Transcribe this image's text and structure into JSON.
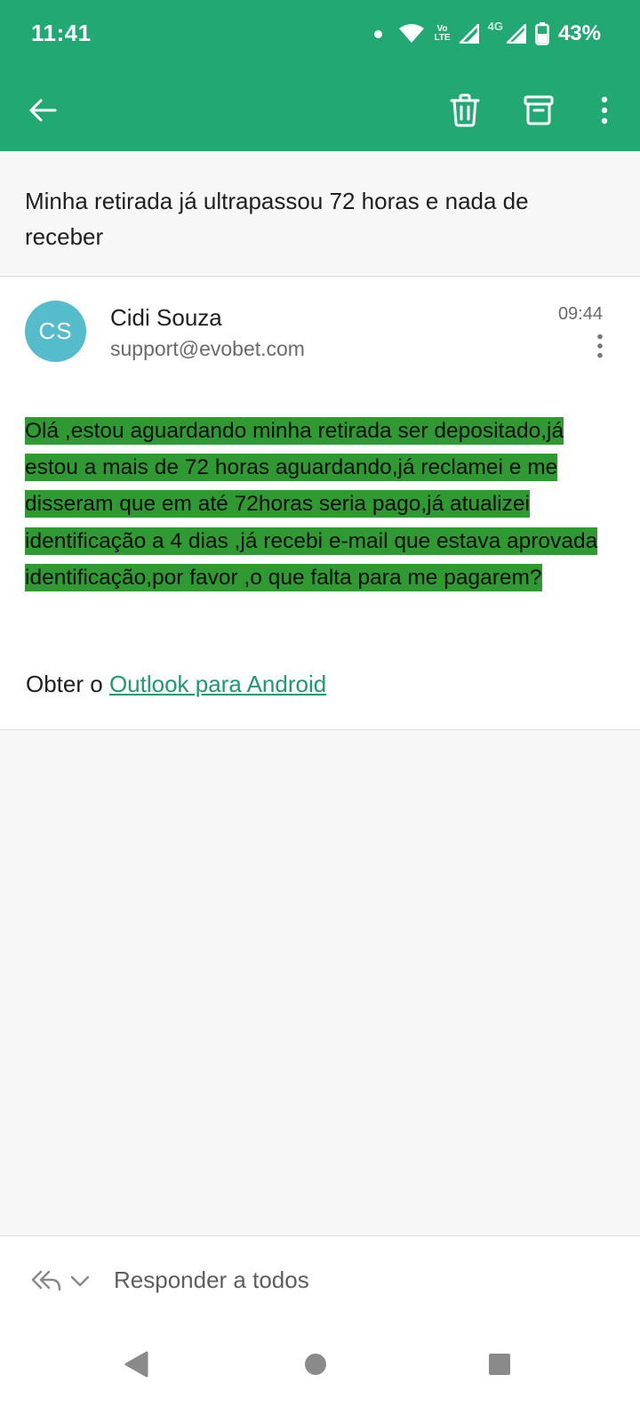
{
  "status_bar": {
    "time": "11:41",
    "volte_top": "Vo",
    "volte_bottom": "LTE",
    "network": "4G",
    "battery": "43%"
  },
  "toolbar": {
    "back_icon": "arrow-left-icon",
    "delete_icon": "trash-icon",
    "archive_icon": "archive-icon",
    "more_icon": "more-vertical-icon"
  },
  "email": {
    "subject": "Minha retirada já ultrapassou 72 horas e nada de receber",
    "avatar_initials": "CS",
    "sender_name": "Cidi Souza",
    "sender_email": "support@evobet.com",
    "time": "09:44",
    "body": "Olá ,estou aguardando minha retirada ser depositado,já estou a mais de 72 horas aguardando,já reclamei e me disseram que em até 72horas seria pago,já atualizei identificação a 4 dias ,já recebi e-mail que estava aprovada identificação,por favor ,o que falta para me pagarem?",
    "signature_prefix": "Obter o ",
    "signature_link": "Outlook para Android"
  },
  "reply": {
    "label": "Responder a todos",
    "icon": "reply-all-icon"
  },
  "navigation": {
    "back": "nav-back-icon",
    "home": "nav-home-icon",
    "recents": "nav-recents-icon"
  },
  "colors": {
    "primary": "#22a873",
    "highlight": "#2f9a32",
    "avatar": "#54bccb",
    "link": "#1f9a6b"
  }
}
